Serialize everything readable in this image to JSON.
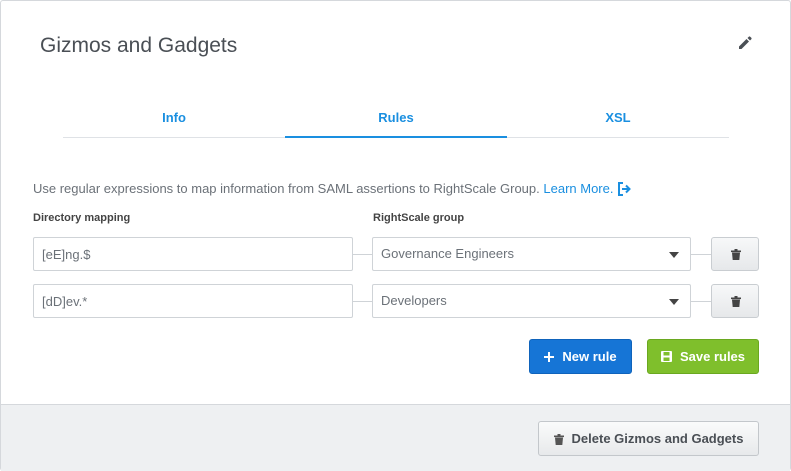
{
  "header": {
    "title": "Gizmos and Gadgets",
    "edit_icon": "pencil-icon"
  },
  "tabs": [
    {
      "label": "Info",
      "active": false
    },
    {
      "label": "Rules",
      "active": true
    },
    {
      "label": "XSL",
      "active": false
    }
  ],
  "description": {
    "text": "Use regular expressions to map information from SAML assertions to RightScale Group.",
    "link": "Learn More.",
    "link_icon": "external-link-icon"
  },
  "columns": {
    "directory": "Directory mapping",
    "group": "RightScale group"
  },
  "rules": [
    {
      "pattern": "[eE]ng.$",
      "group": "Governance Engineers",
      "delete_icon": "trash-icon"
    },
    {
      "pattern": "[dD]ev.*",
      "group": "Developers",
      "delete_icon": "trash-icon"
    }
  ],
  "actions": {
    "new_rule": "New rule",
    "save_rules": "Save rules"
  },
  "footer": {
    "delete_label": "Delete Gizmos and Gadgets"
  },
  "colors": {
    "accent": "#1a8fe0",
    "primary_button": "#1675d6",
    "success_button": "#7fbf2c"
  }
}
